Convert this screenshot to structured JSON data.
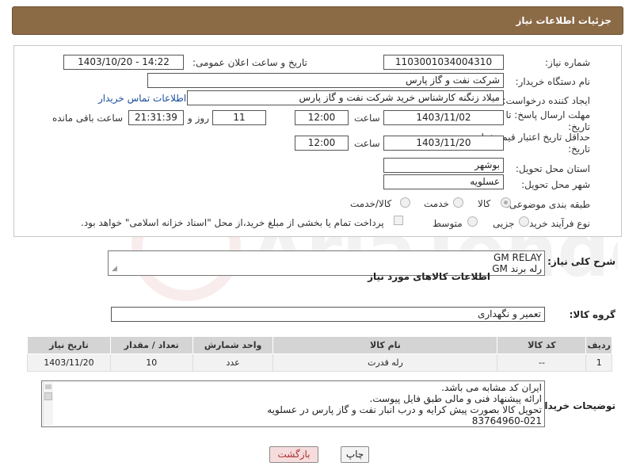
{
  "header": {
    "title": "جزئیات اطلاعات نیاز"
  },
  "fields": {
    "need_number": {
      "label": "شماره نیاز:",
      "value": "1103001034004310"
    },
    "announce_datetime": {
      "label": "تاریخ و ساعت اعلان عمومی:",
      "value": "1403/10/20 - 14:22"
    },
    "buyer_org": {
      "label": "نام دستگاه خریدار:",
      "value": "شرکت نفت و گاز پارس"
    },
    "requester": {
      "label": "ایجاد کننده درخواست:",
      "value": "میلاد زنگنه کارشناس خرید شرکت نفت و گاز پارس"
    },
    "contact_link": "اطلاعات تماس خریدار",
    "reply_deadline": {
      "label1": "مهلت ارسال پاسخ: تا",
      "label2": "تاریخ:",
      "date": "1403/11/02",
      "time_label": "ساعت",
      "time": "12:00",
      "days": "11",
      "days_label": "روز و",
      "remaining": "21:31:39",
      "remaining_label": "ساعت باقی مانده"
    },
    "price_validity": {
      "label1": "حداقل تاریخ اعتبار قیمت: تا",
      "label2": "تاریخ:",
      "date": "1403/11/20",
      "time_label": "ساعت",
      "time": "12:00"
    },
    "province": {
      "label": "استان محل تحویل:",
      "value": "بوشهر"
    },
    "city": {
      "label": "شهر محل تحویل:",
      "value": "عسلویه"
    },
    "category": {
      "label": "طبقه بندی موضوعی:",
      "options": [
        "کالا",
        "خدمت",
        "کالا/خدمت"
      ]
    },
    "process": {
      "label": "نوع فرآیند خرید :",
      "options": [
        "جزیی",
        "متوسط"
      ],
      "note": "پرداخت تمام یا بخشی از مبلغ خرید،از محل \"اسناد خزانه اسلامی\" خواهد بود."
    }
  },
  "description": {
    "label": "شرح کلی نیاز:",
    "line1": "GM RELAY",
    "line2": "رله برند GM"
  },
  "goods_info": {
    "title": "اطلاعات کالاهای مورد نیاز"
  },
  "goods_group": {
    "label": "گروه کالا:",
    "value": "تعمیر و نگهداری"
  },
  "table": {
    "headers": [
      "ردیف",
      "کد کالا",
      "نام کالا",
      "واحد شمارش",
      "تعداد / مقدار",
      "تاریخ نیاز"
    ],
    "rows": [
      [
        "1",
        "--",
        "رله قدرت",
        "عدد",
        "10",
        "1403/11/20"
      ]
    ]
  },
  "buyer_notes": {
    "label": "توضیحات خریدار:",
    "lines": [
      "ایران کد مشابه می باشد.",
      "ارائه پیشنهاد فنی و مالی طبق فایل پیوست.",
      "تحویل کالا بصورت پیش کرایه و درب انبار نفت و گاز پارس در عسلویه",
      "83764960-021"
    ]
  },
  "buttons": {
    "print": "چاپ",
    "back": "بازگشت"
  },
  "watermark": {
    "text": "AriaTender.net"
  },
  "colors": {
    "header_bg": "#8b6a46",
    "link": "#1a4fa0",
    "back_btn": "#f6dcdc"
  }
}
